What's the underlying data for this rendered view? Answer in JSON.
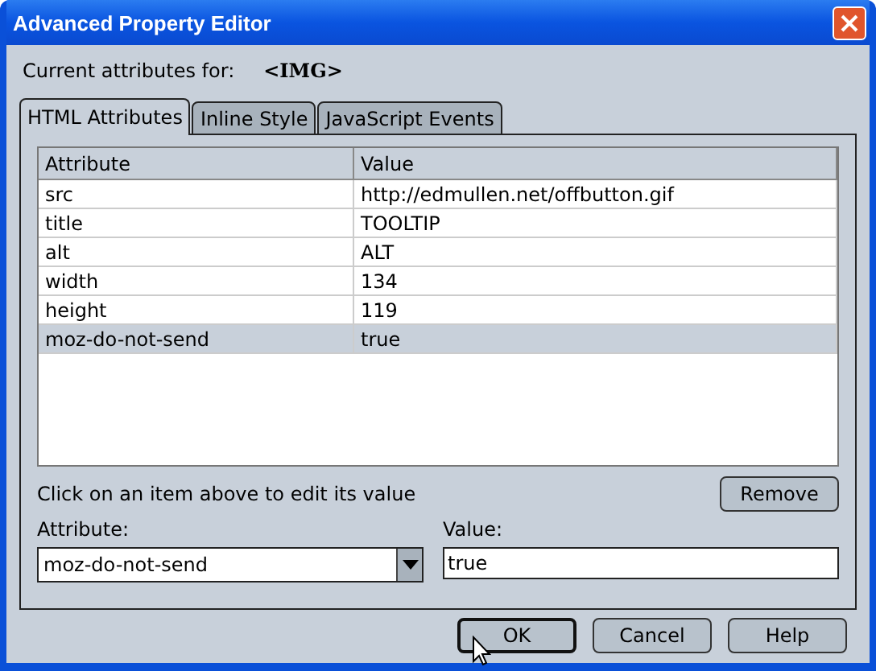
{
  "window": {
    "title": "Advanced Property Editor"
  },
  "header": {
    "label": "Current attributes for:",
    "element": "<IMG>"
  },
  "tabs": [
    {
      "label": "HTML Attributes",
      "selected": true
    },
    {
      "label": "Inline Style",
      "selected": false
    },
    {
      "label": "JavaScript Events",
      "selected": false
    }
  ],
  "table": {
    "columns": [
      "Attribute",
      "Value"
    ],
    "rows": [
      {
        "cells": [
          "src",
          "http://edmullen.net/offbutton.gif"
        ],
        "selected": false
      },
      {
        "cells": [
          "title",
          "TOOLTIP"
        ],
        "selected": false
      },
      {
        "cells": [
          "alt",
          "ALT"
        ],
        "selected": false
      },
      {
        "cells": [
          "width",
          "134"
        ],
        "selected": false
      },
      {
        "cells": [
          "height",
          "119"
        ],
        "selected": false
      },
      {
        "cells": [
          "moz-do-not-send",
          "true"
        ],
        "selected": true
      }
    ]
  },
  "hint": "Click on an item above to edit its value",
  "remove_button": "Remove",
  "attribute_field": {
    "label": "Attribute:",
    "value": "moz-do-not-send"
  },
  "value_field": {
    "label": "Value:",
    "value": "true"
  },
  "buttons": [
    {
      "label": "OK",
      "default": true
    },
    {
      "label": "Cancel",
      "default": false
    },
    {
      "label": "Help",
      "default": false
    }
  ]
}
